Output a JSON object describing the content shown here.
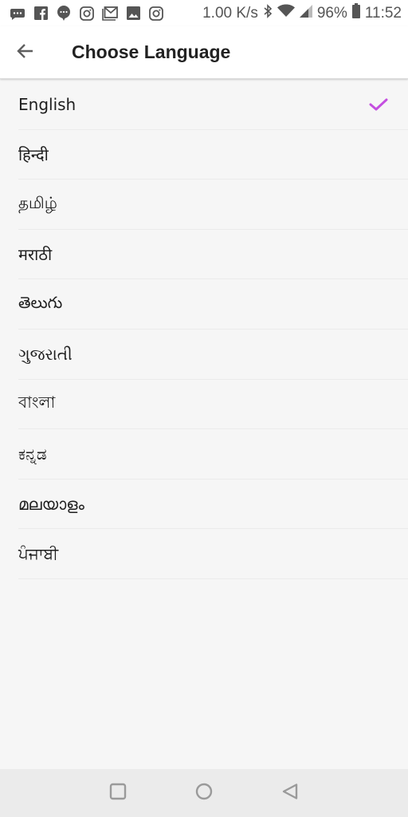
{
  "status_bar": {
    "notification_icons": [
      "message-bubble-icon",
      "facebook-icon",
      "chat-icon",
      "instagram-icon",
      "gmail-icon",
      "gallery-icon",
      "instagram-icon"
    ],
    "network_speed": "1.00 K/s",
    "battery": "96%",
    "time": "11:52"
  },
  "header": {
    "title": "Choose Language",
    "back_icon": "arrow-left-icon"
  },
  "languages": [
    {
      "label": "English",
      "selected": true
    },
    {
      "label": "हिन्दी",
      "selected": false
    },
    {
      "label": "தமிழ்",
      "selected": false
    },
    {
      "label": "मराठी",
      "selected": false
    },
    {
      "label": "తెలుగు",
      "selected": false
    },
    {
      "label": "ગુજરાતી",
      "selected": false
    },
    {
      "label": "বাংলা",
      "selected": false
    },
    {
      "label": "ಕನ್ನಡ",
      "selected": false
    },
    {
      "label": "മലയാളം",
      "selected": false
    },
    {
      "label": "ਪੰਜਾਬੀ",
      "selected": false
    }
  ],
  "colors": {
    "accent": "#c44fe0",
    "selected_check": "#c44fe0"
  },
  "nav_bar": {
    "buttons": [
      "recents-icon",
      "home-icon",
      "back-icon"
    ]
  }
}
